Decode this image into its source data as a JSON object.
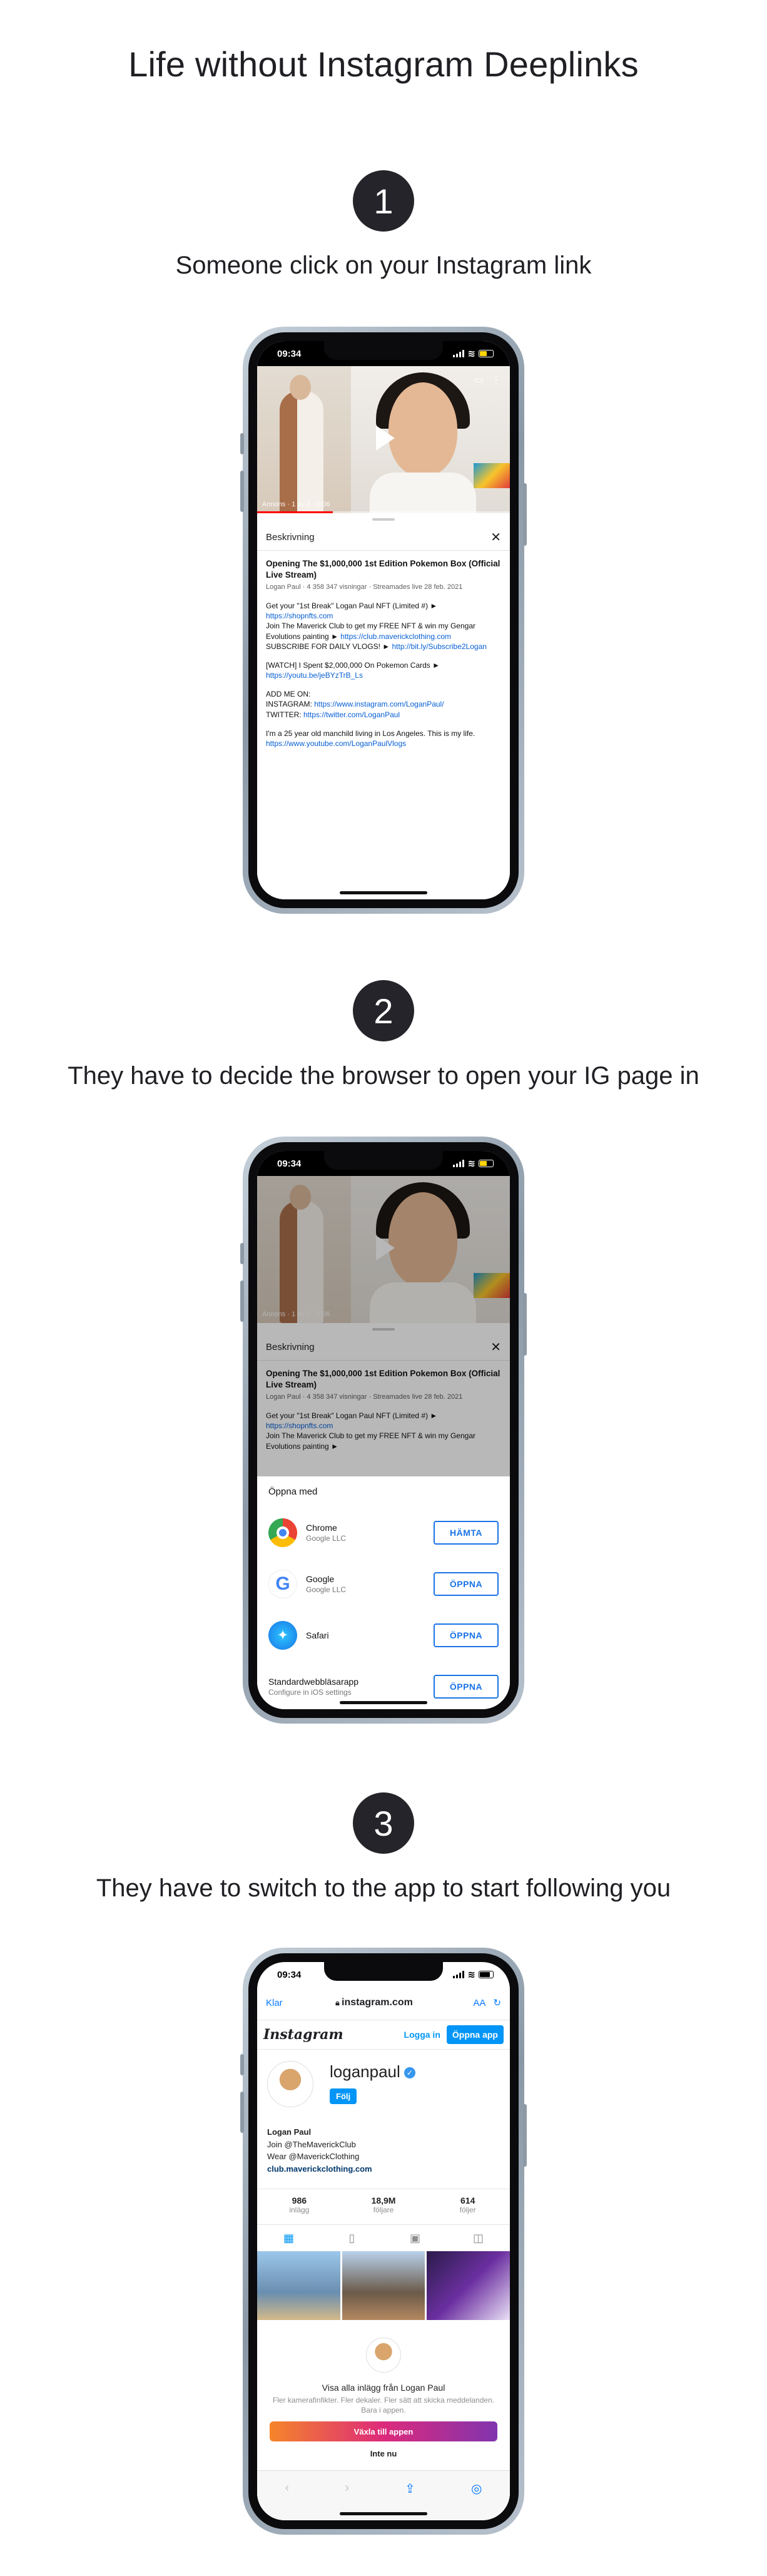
{
  "page_title": "Life without Instagram Deeplinks",
  "steps": [
    {
      "number": "1",
      "title": "Someone click on your Instagram link"
    },
    {
      "number": "2",
      "title": "They have to decide the browser to open your IG page in"
    },
    {
      "number": "3",
      "title": "They have to switch to the app to start following you"
    }
  ],
  "status_time": "09:34",
  "video": {
    "meta": "Annons · 1 av 2 · 0:06"
  },
  "description": {
    "header": "Beskrivning",
    "video_title": "Opening The $1,000,000 1st Edition Pokemon Box (Official Live Stream)",
    "video_meta": "Logan Paul · 4 358 347 visningar · Streamades live 28 feb. 2021",
    "p1_text": "Get your \"1st Break\" Logan Paul NFT (Limited #) ► ",
    "p1_link": "https://shopnfts.com",
    "p2_text": "Join The Maverick Club to get my FREE NFT & win my Gengar Evolutions painting ► ",
    "p2_link": "https://club.maverickclothing.com",
    "p3_text": "SUBSCRIBE FOR DAILY VLOGS! ► ",
    "p3_link": "http://bit.ly/Subscribe2Logan",
    "p4_text": "[WATCH] I Spent $2,000,000 On Pokemon Cards ► ",
    "p4_link": "https://youtu.be/jeBYzTrB_Ls",
    "p5_head": "ADD ME ON:",
    "p5_ig_label": "INSTAGRAM: ",
    "p5_ig_link": "https://www.instagram.com/LoganPaul/",
    "p5_tw_label": "TWITTER: ",
    "p5_tw_link": "https://twitter.com/LoganPaul",
    "p6_text": "I'm a 25 year old manchild living in Los Angeles. This is my life.",
    "p6_link": "https://www.youtube.com/LoganPaulVlogs"
  },
  "open_with": {
    "title": "Öppna med",
    "apps": [
      {
        "name": "Chrome",
        "sub": "Google LLC",
        "button": "HÄMTA",
        "icon": "chrome-icon"
      },
      {
        "name": "Google",
        "sub": "Google LLC",
        "button": "ÖPPNA",
        "icon": "google-icon"
      },
      {
        "name": "Safari",
        "sub": "",
        "button": "ÖPPNA",
        "icon": "safari-icon"
      },
      {
        "name": "Standardwebbläsarapp",
        "sub": "Configure in iOS settings",
        "button": "ÖPPNA",
        "icon": ""
      }
    ]
  },
  "safari": {
    "done": "Klar",
    "url": "instagram.com",
    "aa": "AA"
  },
  "instagram": {
    "logo": "Instagram",
    "login": "Logga in",
    "open_app": "Öppna app",
    "username": "loganpaul",
    "follow": "Följ",
    "bio_name": "Logan Paul",
    "bio_line1": "Join @TheMaverickClub",
    "bio_line2": "Wear @MaverickClothing",
    "bio_link": "club.maverickclothing.com",
    "stats": [
      {
        "n": "986",
        "l": "inlägg"
      },
      {
        "n": "18,9M",
        "l": "följare"
      },
      {
        "n": "614",
        "l": "följer"
      }
    ],
    "modal_title": "Visa alla inlägg från Logan Paul",
    "modal_sub": "Fler kamerafinfikter. Fler dekaler. Fler sätt att skicka meddelanden. Bara i appen.",
    "switch_button": "Växla till appen",
    "not_now": "Inte nu"
  },
  "colors": {
    "badge": "#24242a",
    "youtube_link": "#065fd4",
    "android_blue": "#1a73e8",
    "ig_blue": "#0095f6",
    "ios_blue": "#0a7aff"
  }
}
